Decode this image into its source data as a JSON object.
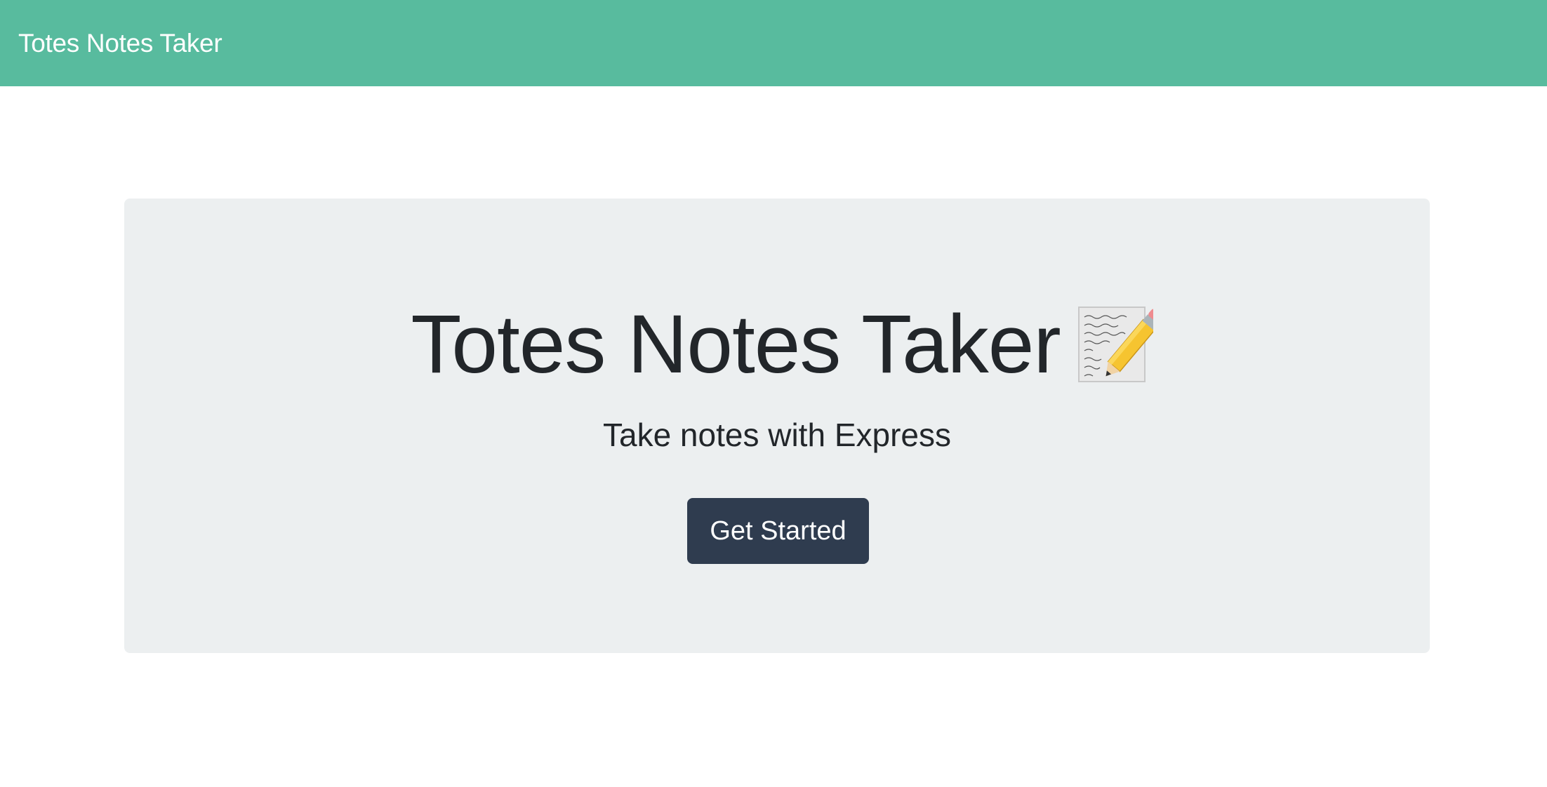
{
  "navbar": {
    "brand": "Totes Notes Taker"
  },
  "hero": {
    "title": "Totes Notes Taker",
    "icon": "memo-pencil-icon",
    "subtitle": "Take notes with Express",
    "cta_label": "Get Started"
  },
  "colors": {
    "navbar_bg": "#58bb9e",
    "jumbotron_bg": "#eceff0",
    "button_bg": "#2f3c4f",
    "text": "#22262a"
  }
}
